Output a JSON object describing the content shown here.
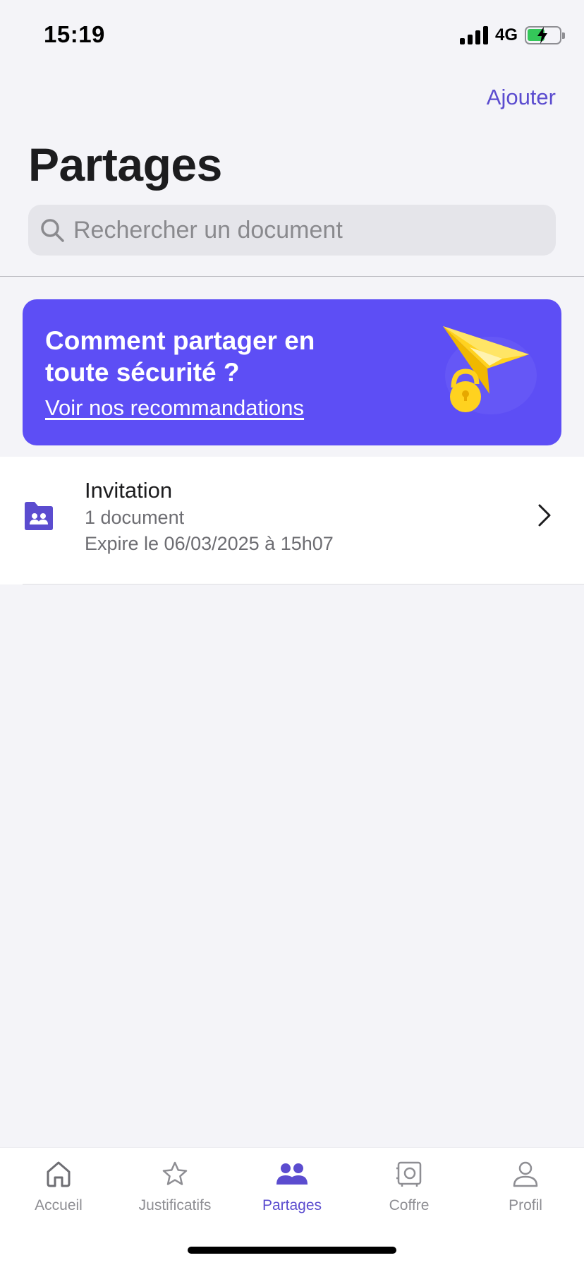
{
  "status": {
    "time": "15:19",
    "network": "4G"
  },
  "header": {
    "add_label": "Ajouter",
    "title": "Partages",
    "search_placeholder": "Rechercher un document"
  },
  "banner": {
    "title": "Comment partager en toute sécurité ?",
    "link": "Voir nos recommandations"
  },
  "shares": [
    {
      "title": "Invitation",
      "count": "1 document",
      "expiry": "Expire le 06/03/2025 à 15h07"
    }
  ],
  "tabs": [
    {
      "label": "Accueil",
      "icon": "house-icon",
      "active": false
    },
    {
      "label": "Justificatifs",
      "icon": "star-icon",
      "active": false
    },
    {
      "label": "Partages",
      "icon": "people-icon",
      "active": true
    },
    {
      "label": "Coffre",
      "icon": "safe-icon",
      "active": false
    },
    {
      "label": "Profil",
      "icon": "person-icon",
      "active": false
    }
  ],
  "colors": {
    "accent": "#5b4ccf",
    "banner_bg": "#5d4ef5",
    "plane_yellow": "#ffd21f",
    "background": "#f4f4f8"
  }
}
